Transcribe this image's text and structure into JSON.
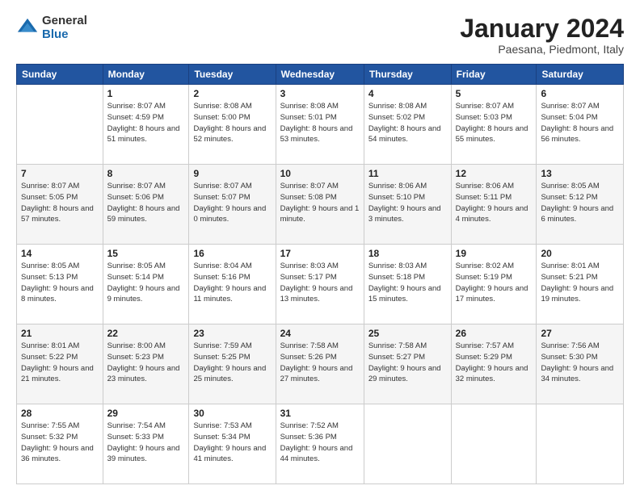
{
  "logo": {
    "general": "General",
    "blue": "Blue"
  },
  "header": {
    "month": "January 2024",
    "location": "Paesana, Piedmont, Italy"
  },
  "weekdays": [
    "Sunday",
    "Monday",
    "Tuesday",
    "Wednesday",
    "Thursday",
    "Friday",
    "Saturday"
  ],
  "weeks": [
    [
      {
        "day": "",
        "sunrise": "",
        "sunset": "",
        "daylight": ""
      },
      {
        "day": "1",
        "sunrise": "Sunrise: 8:07 AM",
        "sunset": "Sunset: 4:59 PM",
        "daylight": "Daylight: 8 hours and 51 minutes."
      },
      {
        "day": "2",
        "sunrise": "Sunrise: 8:08 AM",
        "sunset": "Sunset: 5:00 PM",
        "daylight": "Daylight: 8 hours and 52 minutes."
      },
      {
        "day": "3",
        "sunrise": "Sunrise: 8:08 AM",
        "sunset": "Sunset: 5:01 PM",
        "daylight": "Daylight: 8 hours and 53 minutes."
      },
      {
        "day": "4",
        "sunrise": "Sunrise: 8:08 AM",
        "sunset": "Sunset: 5:02 PM",
        "daylight": "Daylight: 8 hours and 54 minutes."
      },
      {
        "day": "5",
        "sunrise": "Sunrise: 8:07 AM",
        "sunset": "Sunset: 5:03 PM",
        "daylight": "Daylight: 8 hours and 55 minutes."
      },
      {
        "day": "6",
        "sunrise": "Sunrise: 8:07 AM",
        "sunset": "Sunset: 5:04 PM",
        "daylight": "Daylight: 8 hours and 56 minutes."
      }
    ],
    [
      {
        "day": "7",
        "sunrise": "Sunrise: 8:07 AM",
        "sunset": "Sunset: 5:05 PM",
        "daylight": "Daylight: 8 hours and 57 minutes."
      },
      {
        "day": "8",
        "sunrise": "Sunrise: 8:07 AM",
        "sunset": "Sunset: 5:06 PM",
        "daylight": "Daylight: 8 hours and 59 minutes."
      },
      {
        "day": "9",
        "sunrise": "Sunrise: 8:07 AM",
        "sunset": "Sunset: 5:07 PM",
        "daylight": "Daylight: 9 hours and 0 minutes."
      },
      {
        "day": "10",
        "sunrise": "Sunrise: 8:07 AM",
        "sunset": "Sunset: 5:08 PM",
        "daylight": "Daylight: 9 hours and 1 minute."
      },
      {
        "day": "11",
        "sunrise": "Sunrise: 8:06 AM",
        "sunset": "Sunset: 5:10 PM",
        "daylight": "Daylight: 9 hours and 3 minutes."
      },
      {
        "day": "12",
        "sunrise": "Sunrise: 8:06 AM",
        "sunset": "Sunset: 5:11 PM",
        "daylight": "Daylight: 9 hours and 4 minutes."
      },
      {
        "day": "13",
        "sunrise": "Sunrise: 8:05 AM",
        "sunset": "Sunset: 5:12 PM",
        "daylight": "Daylight: 9 hours and 6 minutes."
      }
    ],
    [
      {
        "day": "14",
        "sunrise": "Sunrise: 8:05 AM",
        "sunset": "Sunset: 5:13 PM",
        "daylight": "Daylight: 9 hours and 8 minutes."
      },
      {
        "day": "15",
        "sunrise": "Sunrise: 8:05 AM",
        "sunset": "Sunset: 5:14 PM",
        "daylight": "Daylight: 9 hours and 9 minutes."
      },
      {
        "day": "16",
        "sunrise": "Sunrise: 8:04 AM",
        "sunset": "Sunset: 5:16 PM",
        "daylight": "Daylight: 9 hours and 11 minutes."
      },
      {
        "day": "17",
        "sunrise": "Sunrise: 8:03 AM",
        "sunset": "Sunset: 5:17 PM",
        "daylight": "Daylight: 9 hours and 13 minutes."
      },
      {
        "day": "18",
        "sunrise": "Sunrise: 8:03 AM",
        "sunset": "Sunset: 5:18 PM",
        "daylight": "Daylight: 9 hours and 15 minutes."
      },
      {
        "day": "19",
        "sunrise": "Sunrise: 8:02 AM",
        "sunset": "Sunset: 5:19 PM",
        "daylight": "Daylight: 9 hours and 17 minutes."
      },
      {
        "day": "20",
        "sunrise": "Sunrise: 8:01 AM",
        "sunset": "Sunset: 5:21 PM",
        "daylight": "Daylight: 9 hours and 19 minutes."
      }
    ],
    [
      {
        "day": "21",
        "sunrise": "Sunrise: 8:01 AM",
        "sunset": "Sunset: 5:22 PM",
        "daylight": "Daylight: 9 hours and 21 minutes."
      },
      {
        "day": "22",
        "sunrise": "Sunrise: 8:00 AM",
        "sunset": "Sunset: 5:23 PM",
        "daylight": "Daylight: 9 hours and 23 minutes."
      },
      {
        "day": "23",
        "sunrise": "Sunrise: 7:59 AM",
        "sunset": "Sunset: 5:25 PM",
        "daylight": "Daylight: 9 hours and 25 minutes."
      },
      {
        "day": "24",
        "sunrise": "Sunrise: 7:58 AM",
        "sunset": "Sunset: 5:26 PM",
        "daylight": "Daylight: 9 hours and 27 minutes."
      },
      {
        "day": "25",
        "sunrise": "Sunrise: 7:58 AM",
        "sunset": "Sunset: 5:27 PM",
        "daylight": "Daylight: 9 hours and 29 minutes."
      },
      {
        "day": "26",
        "sunrise": "Sunrise: 7:57 AM",
        "sunset": "Sunset: 5:29 PM",
        "daylight": "Daylight: 9 hours and 32 minutes."
      },
      {
        "day": "27",
        "sunrise": "Sunrise: 7:56 AM",
        "sunset": "Sunset: 5:30 PM",
        "daylight": "Daylight: 9 hours and 34 minutes."
      }
    ],
    [
      {
        "day": "28",
        "sunrise": "Sunrise: 7:55 AM",
        "sunset": "Sunset: 5:32 PM",
        "daylight": "Daylight: 9 hours and 36 minutes."
      },
      {
        "day": "29",
        "sunrise": "Sunrise: 7:54 AM",
        "sunset": "Sunset: 5:33 PM",
        "daylight": "Daylight: 9 hours and 39 minutes."
      },
      {
        "day": "30",
        "sunrise": "Sunrise: 7:53 AM",
        "sunset": "Sunset: 5:34 PM",
        "daylight": "Daylight: 9 hours and 41 minutes."
      },
      {
        "day": "31",
        "sunrise": "Sunrise: 7:52 AM",
        "sunset": "Sunset: 5:36 PM",
        "daylight": "Daylight: 9 hours and 44 minutes."
      },
      {
        "day": "",
        "sunrise": "",
        "sunset": "",
        "daylight": ""
      },
      {
        "day": "",
        "sunrise": "",
        "sunset": "",
        "daylight": ""
      },
      {
        "day": "",
        "sunrise": "",
        "sunset": "",
        "daylight": ""
      }
    ]
  ]
}
